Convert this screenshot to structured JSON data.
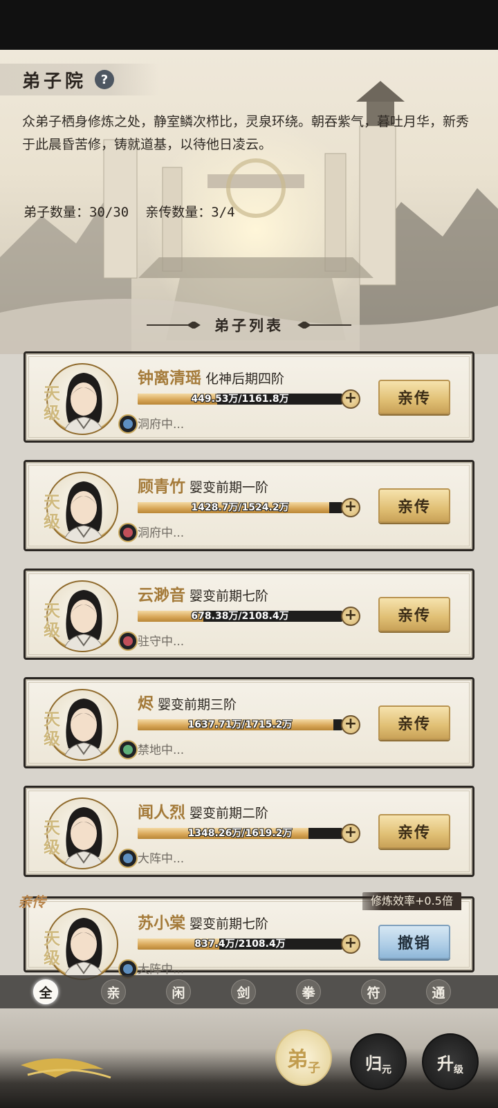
{
  "header": {
    "title": "弟子院",
    "help_icon": "question-circle-icon",
    "description": "众弟子栖身修炼之处，静室鳞次栉比，灵泉环绕。朝吞紫气，暮吐月华，新秀于此晨昏苦修，铸就道基，以待他日凌云。",
    "disciple_count": "弟子数量：30/30",
    "direct_count": "亲传数量：3/4"
  },
  "list_title": "弟子列表",
  "disciples": [
    {
      "grade": "天级",
      "name": "钟离清瑶",
      "rank": "化神后期四阶",
      "progress_text": "449.53万/1161.8万",
      "progress": 0.387,
      "location": "洞府中...",
      "sect_icon": "water-wave-icon",
      "action": "亲传"
    },
    {
      "grade": "天级",
      "name": "顾青竹",
      "rank": "婴变前期一阶",
      "progress_text": "1428.7万/1524.2万",
      "progress": 0.937,
      "location": "洞府中...",
      "sect_icon": "fist-icon",
      "action": "亲传"
    },
    {
      "grade": "天级",
      "name": "云渺音",
      "rank": "婴变前期七阶",
      "progress_text": "678.38万/2108.4万",
      "progress": 0.322,
      "location": "驻守中...",
      "sect_icon": "fist-icon",
      "action": "亲传"
    },
    {
      "grade": "天级",
      "name": "烬",
      "rank": "婴变前期三阶",
      "progress_text": "1637.71万/1715.2万",
      "progress": 0.955,
      "location": "禁地中...",
      "sect_icon": "swirl-icon",
      "action": "亲传"
    },
    {
      "grade": "天级",
      "name": "闻人烈",
      "rank": "婴变前期二阶",
      "progress_text": "1348.26万/1619.2万",
      "progress": 0.833,
      "location": "大阵中...",
      "sect_icon": "water-wave-icon",
      "action": "亲传"
    },
    {
      "grade": "天级",
      "name": "苏小棠",
      "rank": "婴变前期七阶",
      "progress_text": "837.4万/2108.4万",
      "progress": 0.397,
      "location": "大阵中...",
      "sect_icon": "water-wave-icon",
      "action": "撤销"
    }
  ],
  "direct_label": "亲传",
  "efficiency_badge": "修炼效率+0.5倍",
  "filters": [
    "全",
    "亲",
    "闲",
    "剑",
    "拳",
    "符",
    "通"
  ],
  "active_filter": 0,
  "nav": [
    {
      "big": "弟",
      "small": "子"
    },
    {
      "big": "归",
      "small": "元"
    },
    {
      "big": "升",
      "small": "级"
    }
  ]
}
